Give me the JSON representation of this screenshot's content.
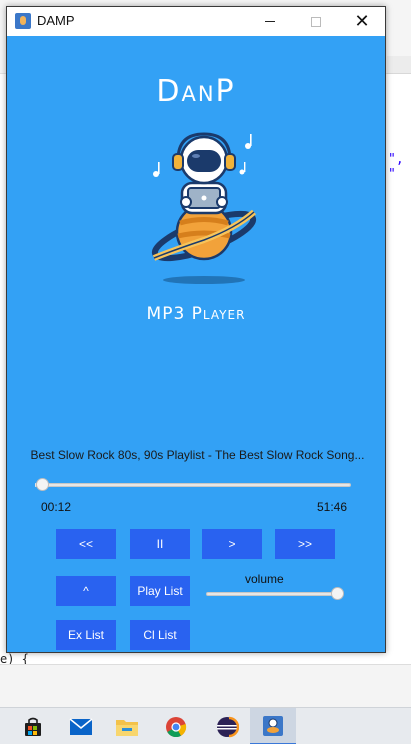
{
  "window": {
    "title": "DAMP",
    "close_glyph": "✕"
  },
  "app": {
    "title": "DanP",
    "subtitle": "MP3 Player"
  },
  "player": {
    "track_title": "Best Slow Rock 80s, 90s Playlist - The Best Slow Rock Song...",
    "current_time": "00:12",
    "total_time": "51:46",
    "progress_fraction": 0.004
  },
  "controls": {
    "prev_label": "<<",
    "pause_label": "II",
    "next_label": ">",
    "fast_forward_label": ">>",
    "up_label": "^",
    "play_list_label": "Play List",
    "ex_list_label": "Ex List",
    "cl_list_label": "Cl List",
    "volume_label": "volume",
    "volume_fraction": 1.0
  },
  "background": {
    "code_fragment": "e) {",
    "string_fragment": "\", \""
  },
  "colors": {
    "app_background": "#33a1f5",
    "button": "#2962f0",
    "button_text": "#ffffff"
  },
  "taskbar": {
    "items": [
      {
        "icon": "store-icon"
      },
      {
        "icon": "mail-icon"
      },
      {
        "icon": "file-explorer-icon"
      },
      {
        "icon": "chrome-icon"
      },
      {
        "icon": "eclipse-icon"
      },
      {
        "icon": "damp-app-icon",
        "active": true
      }
    ]
  }
}
